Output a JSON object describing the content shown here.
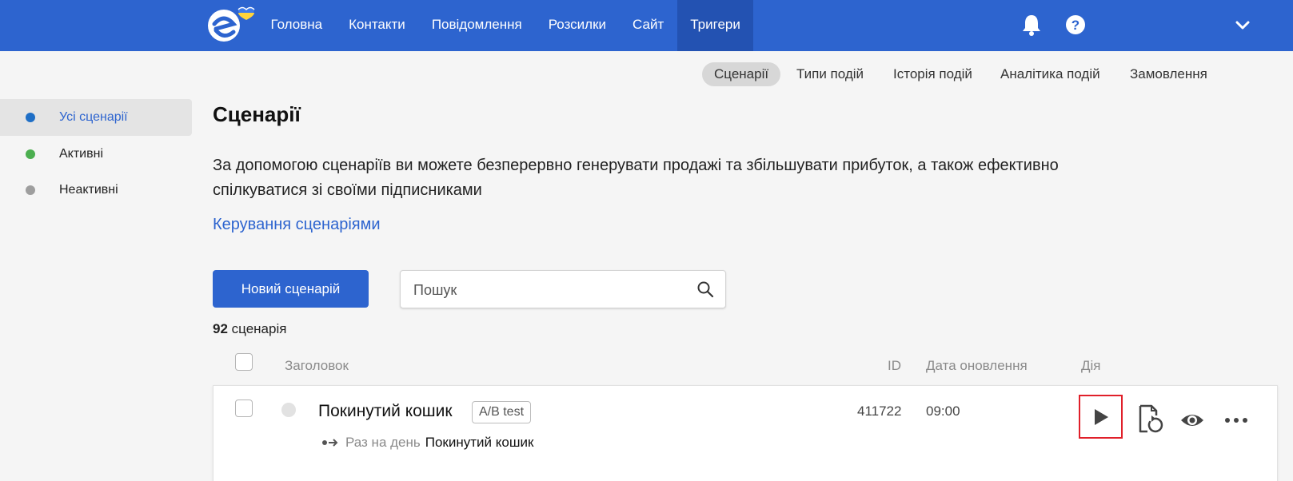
{
  "topnav": {
    "items": [
      "Головна",
      "Контакти",
      "Повідомлення",
      "Розсилки",
      "Сайт",
      "Тригери"
    ],
    "active": "Тригери"
  },
  "subnav": {
    "items": [
      "Сценарії",
      "Типи подій",
      "Історія подій",
      "Аналітика подій",
      "Замовлення"
    ],
    "active": "Сценарії"
  },
  "sidebar": {
    "items": [
      {
        "label": "Усі сценарії",
        "color": "#1f6fc6"
      },
      {
        "label": "Активні",
        "color": "#4caf50"
      },
      {
        "label": "Неактивні",
        "color": "#9e9e9e"
      }
    ]
  },
  "main": {
    "title": "Сценарії",
    "description": "За допомогою сценаріїв ви можете безперервно генерувати продажі та збільшувати прибуток, а також ефективно спілкуватися зі своїми підписниками",
    "manage_link": "Керування сценаріями",
    "new_button": "Новий сценарій",
    "search_placeholder": "Пошук",
    "count_number": "92",
    "count_label": "сценарія"
  },
  "table": {
    "headers": {
      "title": "Заголовок",
      "id": "ID",
      "date": "Дата оновлення",
      "action": "Дія"
    },
    "rows": [
      {
        "title": "Покинутий кошик",
        "badge": "A/B test",
        "frequency": "Раз на день",
        "trigger": "Покинутий кошик",
        "id": "411722",
        "date": "09:00"
      }
    ]
  },
  "colors": {
    "brand": "#2d64cf",
    "highlight": "#e0202a"
  },
  "icons": [
    "logo-icon",
    "bell-icon",
    "help-icon",
    "chevron-down-icon",
    "search-icon",
    "play-icon",
    "restart-file-icon",
    "eye-icon",
    "more-icon"
  ]
}
